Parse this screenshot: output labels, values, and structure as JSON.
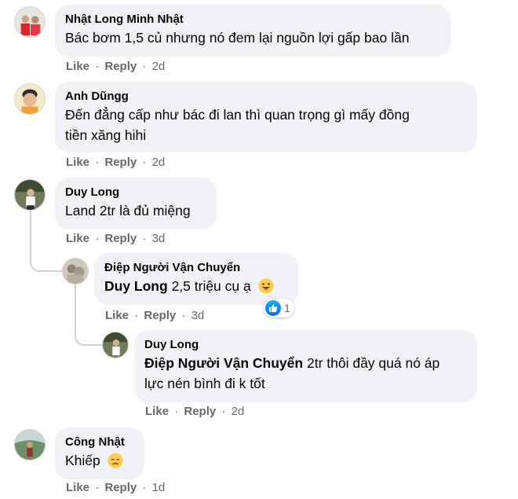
{
  "actions": {
    "like": "Like",
    "reply": "Reply",
    "sep": "·"
  },
  "comments": [
    {
      "author": "Nhật Long Minh Nhật",
      "text": "Bác bơm 1,5 củ nhưng nó đem lại nguồn lợi gấp bao lần",
      "time": "2d"
    },
    {
      "author": "Anh Dũngg",
      "text_line1": "Đến đẳng cấp như bác đi lan thì quan trọng gì mấy đồng",
      "text_line2": "tiền xăng hihi",
      "time": "2d"
    },
    {
      "author": "Duy Long",
      "text": "Land 2tr là đủ miệng",
      "time": "3d",
      "replies": [
        {
          "author": "Điệp Người Vận Chuyển",
          "mention": "Duy Long",
          "text": "2,5 triệu cụ ạ",
          "emoji": "grinning-tongue-emoji",
          "time": "3d",
          "reaction_icon": "like-reaction-icon",
          "reaction_count": "1"
        },
        {
          "author": "Duy Long",
          "mention": "Điệp Người Vận Chuyển",
          "text_line1": "2tr thôi đầy quá nó áp",
          "text_line2": "lực nén bình đi k tốt",
          "time": "2d"
        }
      ]
    },
    {
      "author": "Công Nhật",
      "text": "Khiếp",
      "emoji": "disappointed-face-emoji",
      "time": "1d"
    }
  ],
  "colors": {
    "bubble": "#f0f2f5",
    "meta": "#65676b",
    "text": "#050505",
    "like_blue": "#0866ff"
  }
}
